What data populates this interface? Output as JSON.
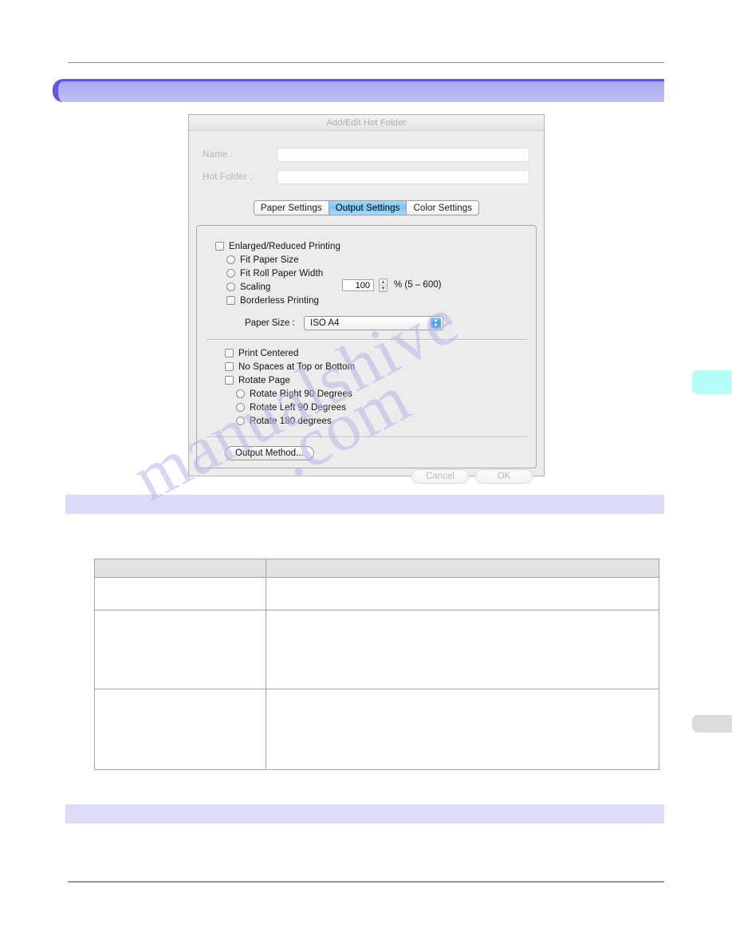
{
  "page": {
    "banners": {
      "main": "",
      "sub_top": "",
      "sub_bottom": ""
    },
    "side_tabs": {
      "cyan": "",
      "gray": ""
    }
  },
  "dialog": {
    "title": "Add/Edit Hot Folder",
    "fields": [
      {
        "label": "Name :",
        "value": "",
        "placeholder": ""
      },
      {
        "label": "Hot Folder :",
        "value": "",
        "placeholder": ""
      }
    ],
    "tabs": [
      {
        "label": "Paper Settings",
        "active": false
      },
      {
        "label": "Output Settings",
        "active": true
      },
      {
        "label": "Color Settings",
        "active": false
      }
    ],
    "output_settings": {
      "enlarged_reduced_printing": "Enlarged/Reduced Printing",
      "fit_paper_size": "Fit Paper Size",
      "fit_roll_paper_width": "Fit Roll Paper Width",
      "scaling": "Scaling",
      "scaling_value": "100",
      "scaling_unit": "% (5 – 600)",
      "borderless_printing": "Borderless Printing",
      "paper_size_label": "Paper Size :",
      "paper_size_value": "ISO A4",
      "print_centered": "Print Centered",
      "no_spaces": "No Spaces at Top or Bottom",
      "rotate_page": "Rotate Page",
      "rotate_right_90": "Rotate Right 90 Degrees",
      "rotate_left_90": "Rotate Left 90 Degrees",
      "rotate_180": "Rotate 180 degrees",
      "output_method_button": "Output Method...",
      "stepper_up": "▲",
      "stepper_down": "▼",
      "select_arrow_up": "▲",
      "select_arrow_down": "▼"
    },
    "footer": {
      "cancel": "Cancel",
      "ok": "OK"
    }
  },
  "table": {
    "headers": [
      "",
      ""
    ],
    "rows": [
      [
        "",
        ""
      ],
      [
        "",
        ""
      ],
      [
        "",
        ""
      ]
    ]
  },
  "watermark": {
    "line1": "manualshive",
    "line2": ".com"
  },
  "colors": {
    "banner_accent": "#5d57e8",
    "banner_fill": "#b8b5f6",
    "banner_light": "#dddcf7",
    "tab_active": "#7cc6f8",
    "side_tab_cyan": "#b6fdf8",
    "side_tab_gray": "#dcdcdc",
    "table_header": "#e2e2e2",
    "rule": "#8a8a8a"
  }
}
